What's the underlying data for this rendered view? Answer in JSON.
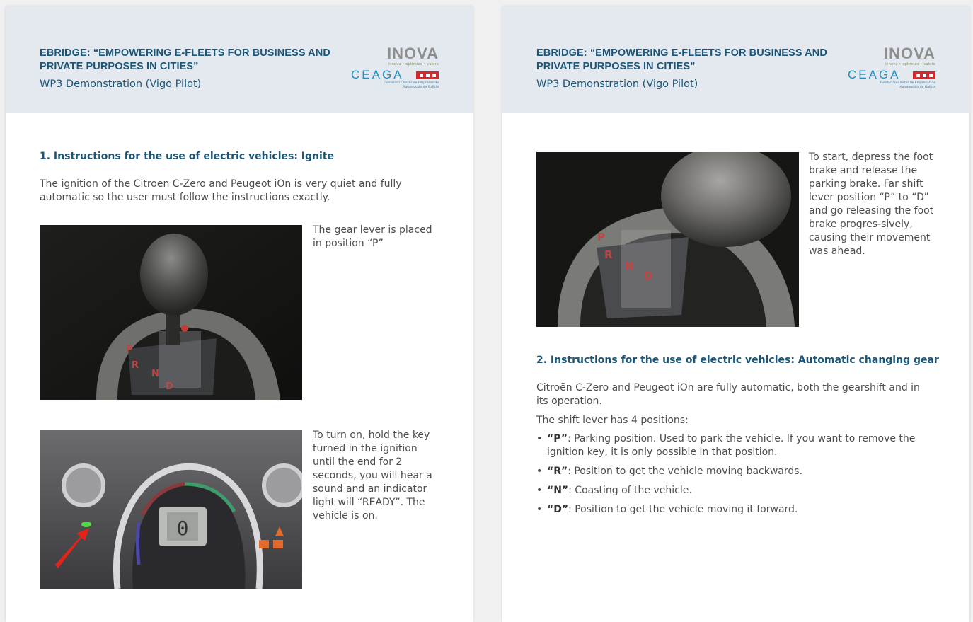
{
  "header": {
    "title": "EBRIDGE: “EMPOWERING E-FLEETS FOR BUSINESS AND PRIVATE PURPOSES IN CITIES”",
    "subtitle": "WP3 Demonstration (Vigo Pilot)",
    "logo_inova": "INOVA",
    "logo_inova_tagline": "innova • optimiza • valora",
    "logo_ceaga": "CEAGA",
    "logo_ceaga_caption": "Fundación Cluster de Empresas de Automoción de Galicia"
  },
  "left_page": {
    "section_title": "1. Instructions for the use of electric vehicles: Ignite",
    "intro": "The ignition of the Citroen C-Zero and Peugeot iOn is very quiet and fully automatic so the user must follow the instructions exactly.",
    "photo1_caption": "The gear lever is placed in position “P”",
    "photo1_icon": "gear-lever-photo",
    "photo2_caption": "To turn on, hold the key turned in the ignition until the end for 2 seconds, you will hear a sound and an indicator light will “READY”. The vehicle is on.",
    "photo2_icon": "dashboard-photo",
    "photo2_readout": "0"
  },
  "right_page": {
    "photo_caption": "To start, depress the foot brake and release the parking brake. Far shift lever position “P” to “D” and go releasing the foot brake progres-sively, causing their movement was ahead.",
    "photo_icon": "gear-shifter-photo",
    "section_title": "2. Instructions for the use of electric vehicles: Automatic changing gear",
    "para1": "Citroën C-Zero and Peugeot iOn are fully automatic, both the gearshift and in its operation.",
    "para2": "The shift lever has 4 positions:",
    "positions": [
      {
        "key": "“P”",
        "text": ": Parking position. Used to park the vehicle. If you want to remove the ignition key, it is only possible in that position."
      },
      {
        "key": "“R”",
        "text": ": Position to get the vehicle moving backwards."
      },
      {
        "key": "“N”",
        "text": ": Coasting of the vehicle."
      },
      {
        "key": "“D”",
        "text": ": Position to get the vehicle moving it forward."
      }
    ]
  },
  "gear_letters": [
    "P",
    "R",
    "N",
    "D"
  ],
  "colors": {
    "heading": "#1b5678",
    "band": "#e3e9ef",
    "ceaga_blue": "#1f8fc0",
    "ceaga_red": "#d9262b"
  }
}
